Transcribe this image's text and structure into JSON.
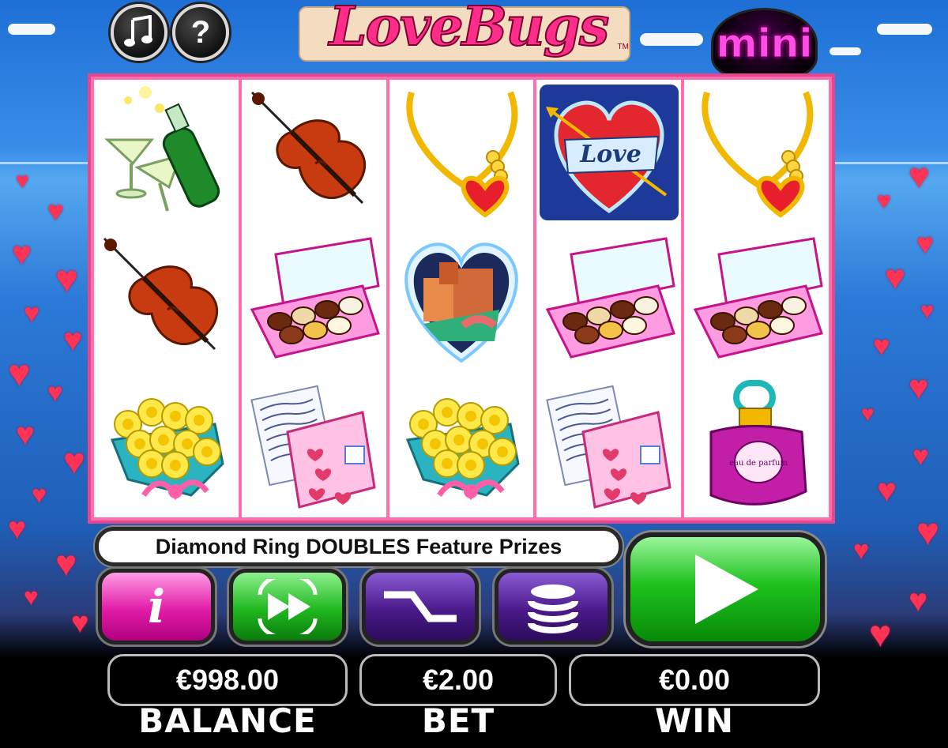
{
  "game": {
    "logo_text": "LoveBugs",
    "trademark": "TM",
    "mini_badge": "mini"
  },
  "top_buttons": {
    "music_icon": "music-note",
    "help_label": "?"
  },
  "reels": [
    [
      "champagne",
      "violin",
      "yellow-roses"
    ],
    [
      "violin",
      "chocolate-box",
      "love-letter"
    ],
    [
      "heart-necklace",
      "venice-heart",
      "yellow-roses"
    ],
    [
      "love-heart-wild",
      "chocolate-box",
      "love-letter"
    ],
    [
      "heart-necklace",
      "chocolate-box",
      "perfume-bottle"
    ]
  ],
  "symbols": {
    "love_banner": "Love",
    "perfume_label": "eau de parfum"
  },
  "message": "Diamond Ring DOUBLES Feature Prizes",
  "controls": {
    "info_label": "i",
    "autoplay_icon": "fast-forward-icon",
    "lines_icon": "lines-icon",
    "coins_icon": "coin-stack-icon",
    "spin_icon": "play-icon"
  },
  "meters": {
    "balance": "€998.00",
    "bet": "€2.00",
    "win": "€0.00",
    "balance_label": "BALANCE",
    "bet_label": "BET",
    "win_label": "WIN"
  },
  "colors": {
    "frame": "#e7468d",
    "spin": "#1fc21f",
    "info": "#e11ba8",
    "lines": "#4a1a8a"
  }
}
